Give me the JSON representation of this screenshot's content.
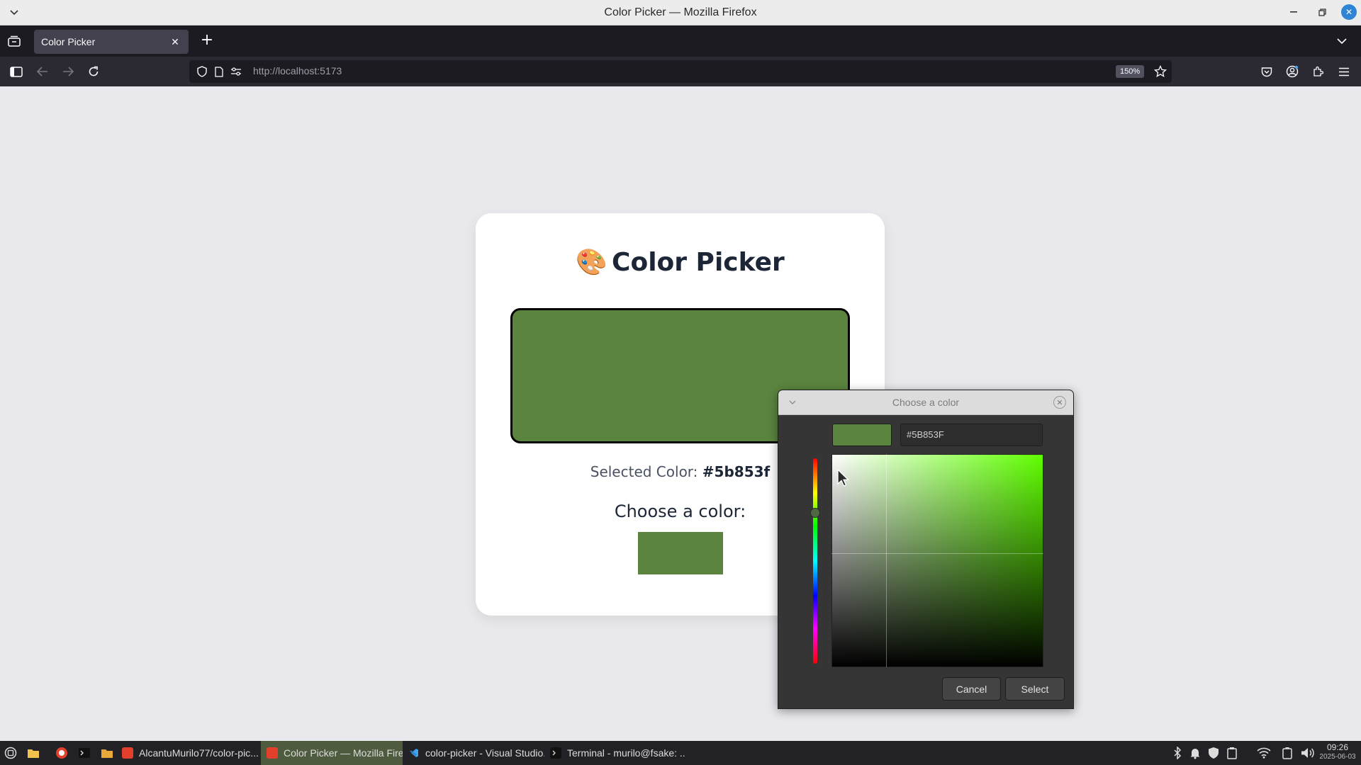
{
  "window": {
    "title": "Color Picker — Mozilla Firefox"
  },
  "tabs": [
    {
      "label": "Color Picker",
      "active": true
    }
  ],
  "navbar": {
    "url": "http://localhost:5173",
    "zoom": "150%"
  },
  "page": {
    "palette_icon": "🎨",
    "heading": "Color Picker",
    "selected_label": "Selected Color:",
    "selected_value": "#5b853f",
    "choose_label": "Choose a color:",
    "current_color": "#5b853f"
  },
  "dialog": {
    "title": "Choose a color",
    "hex_value": "#5B853F",
    "hue_color": "#5fff00",
    "cancel_label": "Cancel",
    "select_label": "Select"
  },
  "taskbar": {
    "tasks": [
      {
        "label": "AlcantuMurilo77/color-pic...",
        "icon": "firefox-icon",
        "active": false
      },
      {
        "label": "Color Picker — Mozilla Fire...",
        "icon": "firefox-icon",
        "active": true
      },
      {
        "label": "color-picker - Visual Studio...",
        "icon": "vscode-icon",
        "active": false
      },
      {
        "label": "Terminal - murilo@fsake: ...",
        "icon": "terminal-icon",
        "active": false
      }
    ],
    "clock_time": "09:26",
    "clock_date": "2025-06-03"
  },
  "colors": {
    "accent_close": "#2f84d4",
    "active_task": "#4e5b3e",
    "firefox_red": "#e2402c"
  }
}
